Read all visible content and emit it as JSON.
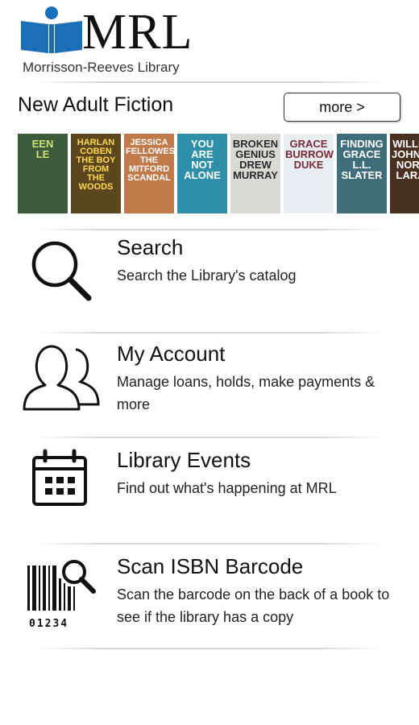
{
  "header": {
    "logo_text": "MRL",
    "logo_subtitle": "Morrisson-Reeves Library"
  },
  "section": {
    "title": "New Adult Fiction",
    "more_label": "more >"
  },
  "covers": [
    {
      "title_text": "EEN\nLE",
      "bg": "#3d5a3a",
      "fg": "#cfe07a"
    },
    {
      "title_text": "HARLAN\nCOBEN\nTHE BOY\nFROM\nTHE WOODS",
      "bg": "#5b4620",
      "fg": "#ffd84a"
    },
    {
      "title_text": "JESSICA\nFELLOWES\nTHE\nMITFORD\nSCANDAL",
      "bg": "#c07a4a",
      "fg": "#ffffff"
    },
    {
      "title_text": "YOU\nARE\nNOT\nALONE",
      "bg": "#2f8fa8",
      "fg": "#ffffff"
    },
    {
      "title_text": "BROKEN\nGENIUS\nDREW\nMURRAY",
      "bg": "#d9d9d6",
      "fg": "#2a2a2a"
    },
    {
      "title_text": "GRACE\nBURROWES\nDUKE",
      "bg": "#e8eef0",
      "fg": "#7a2a3a"
    },
    {
      "title_text": "FINDING\nGRACE\nL.L. SLATER",
      "bg": "#3f6e7a",
      "fg": "#ffffff"
    },
    {
      "title_text": "WILLIAM\nJOHNSTONE\nNORTH\nLARAM",
      "bg": "#4a3020",
      "fg": "#ffffff"
    }
  ],
  "menu": [
    {
      "title": "Search",
      "desc": "Search the Library's catalog"
    },
    {
      "title": "My Account",
      "desc": "Manage loans, holds, make payments & more"
    },
    {
      "title": "Library Events",
      "desc": "Find out what's happening at MRL"
    },
    {
      "title": "Scan ISBN Barcode",
      "desc": "Scan the barcode on the back of a book to see if the library has a copy"
    }
  ],
  "barcode_digits": "01234",
  "colors": {
    "logo_blue": "#1a6fb5"
  },
  "icons": [
    "book-logo-icon",
    "search-icon",
    "account-icon",
    "calendar-icon",
    "barcode-icon"
  ]
}
